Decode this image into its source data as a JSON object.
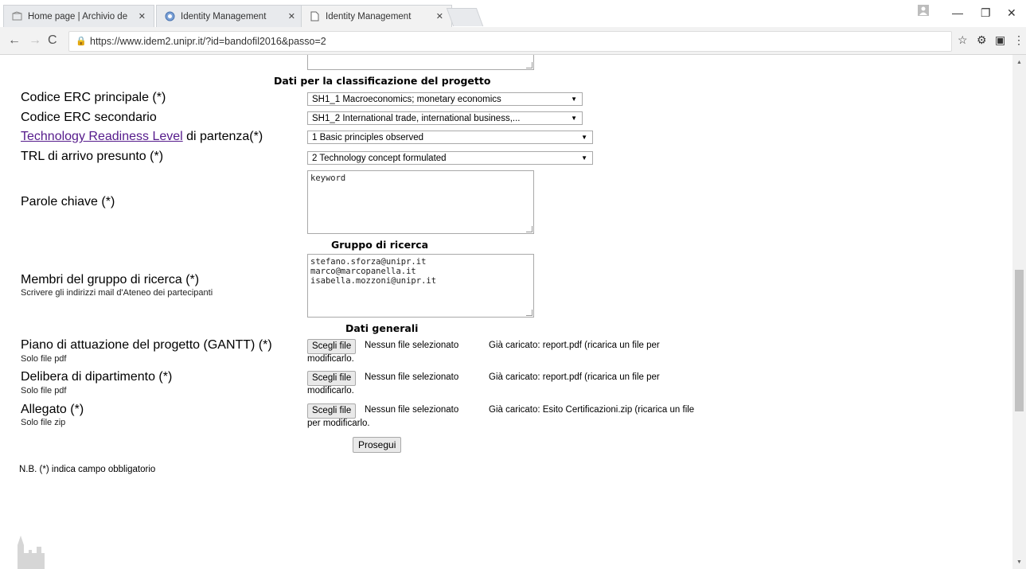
{
  "browser": {
    "tabs": [
      {
        "label": "Home page | Archivio de",
        "icon": "archive-icon"
      },
      {
        "label": "Identity Management",
        "icon": "globe-icon"
      },
      {
        "label": "Identity Management",
        "icon": "page-icon"
      }
    ],
    "url": "https://www.idem2.unipr.it/?id=bandofil2016&passo=2"
  },
  "form": {
    "section_classification": "Dati per la classificazione del progetto",
    "erc_primary_label": "Codice ERC principale (*)",
    "erc_primary_value": "SH1_1 Macroeconomics; monetary economics",
    "erc_secondary_label": "Codice ERC secondario",
    "erc_secondary_value": "SH1_2 International trade, international business,...",
    "trl_link": "Technology Readiness Level",
    "trl_label_rest": " di partenza(*)",
    "trl_start_value": "1 Basic principles observed",
    "trl_end_label": "TRL di arrivo presunto (*)",
    "trl_end_value": "2 Technology concept formulated",
    "keywords_label": "Parole chiave (*)",
    "keywords_value": "keyword",
    "section_group": "Gruppo di ricerca",
    "members_label": "Membri del gruppo di ricerca (*)",
    "members_hint": "Scrivere gli indirizzi mail d'Ateneo dei partecipanti",
    "members_value": "stefano.sforza@unipr.it\nmarco@marcopanella.it\nisabella.mozzoni@unipr.it",
    "section_general": "Dati generali",
    "gantt_label": "Piano di attuazione del progetto (GANTT) (*)",
    "gantt_hint": "Solo file pdf",
    "gantt_uploaded": "Già caricato: report.pdf (ricarica un file per",
    "gantt_cont": "modificarlo.",
    "delibera_label": "Delibera di dipartimento (*)",
    "delibera_hint": "Solo file pdf",
    "delibera_uploaded": "Già caricato: report.pdf (ricarica un file per",
    "delibera_cont": "modificarlo.",
    "allegato_label": "Allegato (*)",
    "allegato_hint": "Solo file zip",
    "allegato_uploaded": "Già caricato: Esito Certificazioni.zip (ricarica un file",
    "allegato_cont": "per modificarlo.",
    "choose_file": "Scegli file",
    "no_file": "Nessun file selezionato",
    "proceed": "Prosegui",
    "note": "N.B. (*) indica campo obbligatorio"
  }
}
